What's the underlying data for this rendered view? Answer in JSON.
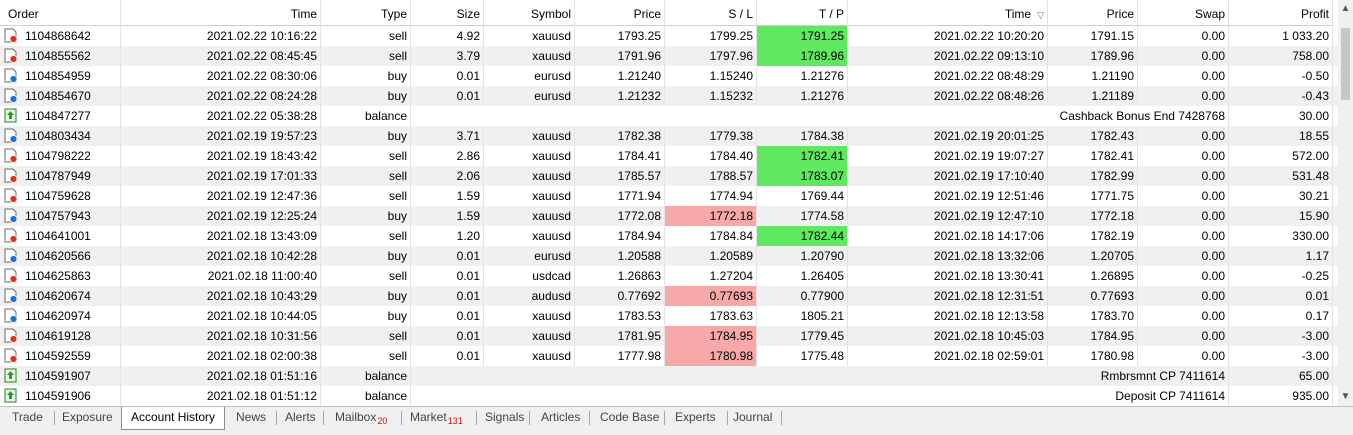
{
  "columns": [
    "Order",
    "Time",
    "Type",
    "Size",
    "Symbol",
    "Price",
    "S / L",
    "T / P",
    "Time",
    "Price",
    "Swap",
    "Profit"
  ],
  "sort_indicator": "▽",
  "rows": [
    {
      "order": "1104868642",
      "time": "2021.02.22 10:16:22",
      "type": "sell",
      "size": "4.92",
      "symbol": "xauusd",
      "price": "1793.25",
      "sl": "1799.25",
      "tp": "1791.25",
      "ctime": "2021.02.22 10:20:20",
      "cprice": "1791.15",
      "swap": "0.00",
      "profit": "1 033.20",
      "icon": "sell-order-icon",
      "tp_hl": "green"
    },
    {
      "order": "1104855562",
      "time": "2021.02.22 08:45:45",
      "type": "sell",
      "size": "3.79",
      "symbol": "xauusd",
      "price": "1791.96",
      "sl": "1797.96",
      "tp": "1789.96",
      "ctime": "2021.02.22 09:13:10",
      "cprice": "1789.96",
      "swap": "0.00",
      "profit": "758.00",
      "icon": "sell-order-icon",
      "tp_hl": "green"
    },
    {
      "order": "1104854959",
      "time": "2021.02.22 08:30:06",
      "type": "buy",
      "size": "0.01",
      "symbol": "eurusd",
      "price": "1.21240",
      "sl": "1.15240",
      "tp": "1.21276",
      "ctime": "2021.02.22 08:48:29",
      "cprice": "1.21190",
      "swap": "0.00",
      "profit": "-0.50",
      "icon": "buy-order-icon"
    },
    {
      "order": "1104854670",
      "time": "2021.02.22 08:24:28",
      "type": "buy",
      "size": "0.01",
      "symbol": "eurusd",
      "price": "1.21232",
      "sl": "1.15232",
      "tp": "1.21276",
      "ctime": "2021.02.22 08:48:26",
      "cprice": "1.21189",
      "swap": "0.00",
      "profit": "-0.43",
      "icon": "buy-order-icon"
    },
    {
      "order": "1104847277",
      "time": "2021.02.22 05:38:28",
      "type": "balance",
      "comment": "Cashback Bonus End 7428768",
      "profit": "30.00",
      "icon": "balance-icon"
    },
    {
      "order": "1104803434",
      "time": "2021.02.19 19:57:23",
      "type": "buy",
      "size": "3.71",
      "symbol": "xauusd",
      "price": "1782.38",
      "sl": "1779.38",
      "tp": "1784.38",
      "ctime": "2021.02.19 20:01:25",
      "cprice": "1782.43",
      "swap": "0.00",
      "profit": "18.55",
      "icon": "buy-order-icon"
    },
    {
      "order": "1104798222",
      "time": "2021.02.19 18:43:42",
      "type": "sell",
      "size": "2.86",
      "symbol": "xauusd",
      "price": "1784.41",
      "sl": "1784.40",
      "tp": "1782.41",
      "ctime": "2021.02.19 19:07:27",
      "cprice": "1782.41",
      "swap": "0.00",
      "profit": "572.00",
      "icon": "sell-order-icon",
      "tp_hl": "green"
    },
    {
      "order": "1104787949",
      "time": "2021.02.19 17:01:33",
      "type": "sell",
      "size": "2.06",
      "symbol": "xauusd",
      "price": "1785.57",
      "sl": "1788.57",
      "tp": "1783.07",
      "ctime": "2021.02.19 17:10:40",
      "cprice": "1782.99",
      "swap": "0.00",
      "profit": "531.48",
      "icon": "sell-order-icon",
      "tp_hl": "green"
    },
    {
      "order": "1104759628",
      "time": "2021.02.19 12:47:36",
      "type": "sell",
      "size": "1.59",
      "symbol": "xauusd",
      "price": "1771.94",
      "sl": "1774.94",
      "tp": "1769.44",
      "ctime": "2021.02.19 12:51:46",
      "cprice": "1771.75",
      "swap": "0.00",
      "profit": "30.21",
      "icon": "sell-order-icon"
    },
    {
      "order": "1104757943",
      "time": "2021.02.19 12:25:24",
      "type": "buy",
      "size": "1.59",
      "symbol": "xauusd",
      "price": "1772.08",
      "sl": "1772.18",
      "tp": "1774.58",
      "ctime": "2021.02.19 12:47:10",
      "cprice": "1772.18",
      "swap": "0.00",
      "profit": "15.90",
      "icon": "buy-order-icon",
      "sl_hl": "red"
    },
    {
      "order": "1104641001",
      "time": "2021.02.18 13:43:09",
      "type": "sell",
      "size": "1.20",
      "symbol": "xauusd",
      "price": "1784.94",
      "sl": "1784.84",
      "tp": "1782.44",
      "ctime": "2021.02.18 14:17:06",
      "cprice": "1782.19",
      "swap": "0.00",
      "profit": "330.00",
      "icon": "sell-order-icon",
      "tp_hl": "green"
    },
    {
      "order": "1104620566",
      "time": "2021.02.18 10:42:28",
      "type": "buy",
      "size": "0.01",
      "symbol": "eurusd",
      "price": "1.20588",
      "sl": "1.20589",
      "tp": "1.20790",
      "ctime": "2021.02.18 13:32:06",
      "cprice": "1.20705",
      "swap": "0.00",
      "profit": "1.17",
      "icon": "buy-order-icon"
    },
    {
      "order": "1104625863",
      "time": "2021.02.18 11:00:40",
      "type": "sell",
      "size": "0.01",
      "symbol": "usdcad",
      "price": "1.26863",
      "sl": "1.27204",
      "tp": "1.26405",
      "ctime": "2021.02.18 13:30:41",
      "cprice": "1.26895",
      "swap": "0.00",
      "profit": "-0.25",
      "icon": "sell-order-icon"
    },
    {
      "order": "1104620674",
      "time": "2021.02.18 10:43:29",
      "type": "buy",
      "size": "0.01",
      "symbol": "audusd",
      "price": "0.77692",
      "sl": "0.77693",
      "tp": "0.77900",
      "ctime": "2021.02.18 12:31:51",
      "cprice": "0.77693",
      "swap": "0.00",
      "profit": "0.01",
      "icon": "buy-order-icon",
      "sl_hl": "red"
    },
    {
      "order": "1104620974",
      "time": "2021.02.18 10:44:05",
      "type": "buy",
      "size": "0.01",
      "symbol": "xauusd",
      "price": "1783.53",
      "sl": "1783.63",
      "tp": "1805.21",
      "ctime": "2021.02.18 12:13:58",
      "cprice": "1783.70",
      "swap": "0.00",
      "profit": "0.17",
      "icon": "buy-order-icon"
    },
    {
      "order": "1104619128",
      "time": "2021.02.18 10:31:56",
      "type": "sell",
      "size": "0.01",
      "symbol": "xauusd",
      "price": "1781.95",
      "sl": "1784.95",
      "tp": "1779.45",
      "ctime": "2021.02.18 10:45:03",
      "cprice": "1784.95",
      "swap": "0.00",
      "profit": "-3.00",
      "icon": "sell-order-icon",
      "sl_hl": "red"
    },
    {
      "order": "1104592559",
      "time": "2021.02.18 02:00:38",
      "type": "sell",
      "size": "0.01",
      "symbol": "xauusd",
      "price": "1777.98",
      "sl": "1780.98",
      "tp": "1775.48",
      "ctime": "2021.02.18 02:59:01",
      "cprice": "1780.98",
      "swap": "0.00",
      "profit": "-3.00",
      "icon": "sell-order-icon",
      "sl_hl": "red"
    },
    {
      "order": "1104591907",
      "time": "2021.02.18 01:51:16",
      "type": "balance",
      "comment": "Rmbrsmnt CP 7411614",
      "profit": "65.00",
      "icon": "balance-icon"
    },
    {
      "order": "1104591906",
      "time": "2021.02.18 01:51:12",
      "type": "balance",
      "comment": "Deposit CP 7411614",
      "profit": "935.00",
      "icon": "balance-icon"
    }
  ],
  "tabs": [
    {
      "label": "Trade"
    },
    {
      "label": "Exposure"
    },
    {
      "label": "Account History",
      "active": true
    },
    {
      "label": "News"
    },
    {
      "label": "Alerts"
    },
    {
      "label": "Mailbox",
      "badge": "20"
    },
    {
      "label": "Market",
      "badge": "131"
    },
    {
      "label": "Signals"
    },
    {
      "label": "Articles"
    },
    {
      "label": "Code Base"
    },
    {
      "label": "Experts"
    },
    {
      "label": "Journal"
    }
  ],
  "colors": {
    "tp_hit": "#60e860",
    "sl_hit": "#f7a8a8",
    "alt_row": "#f0f0f0",
    "sell_marker": "#e0301e",
    "buy_marker": "#1e6fe0",
    "balance_arrow": "#2a9d2a"
  }
}
